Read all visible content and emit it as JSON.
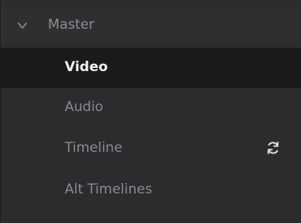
{
  "panel": {
    "header": {
      "label": "Master",
      "icon": "chevron-down-icon",
      "expanded": true
    },
    "items": [
      {
        "label": "Video",
        "selected": true
      },
      {
        "label": "Audio",
        "selected": false
      },
      {
        "label": "Timeline",
        "selected": false,
        "trailing_icon": "sync-icon"
      },
      {
        "label": "Alt Timelines",
        "selected": false
      }
    ]
  },
  "colors": {
    "panel_background": "#2c2c2e",
    "selected_background": "#1a1a1b",
    "selected_text": "#f2f2f4",
    "muted_text": "#8a8a8e"
  }
}
